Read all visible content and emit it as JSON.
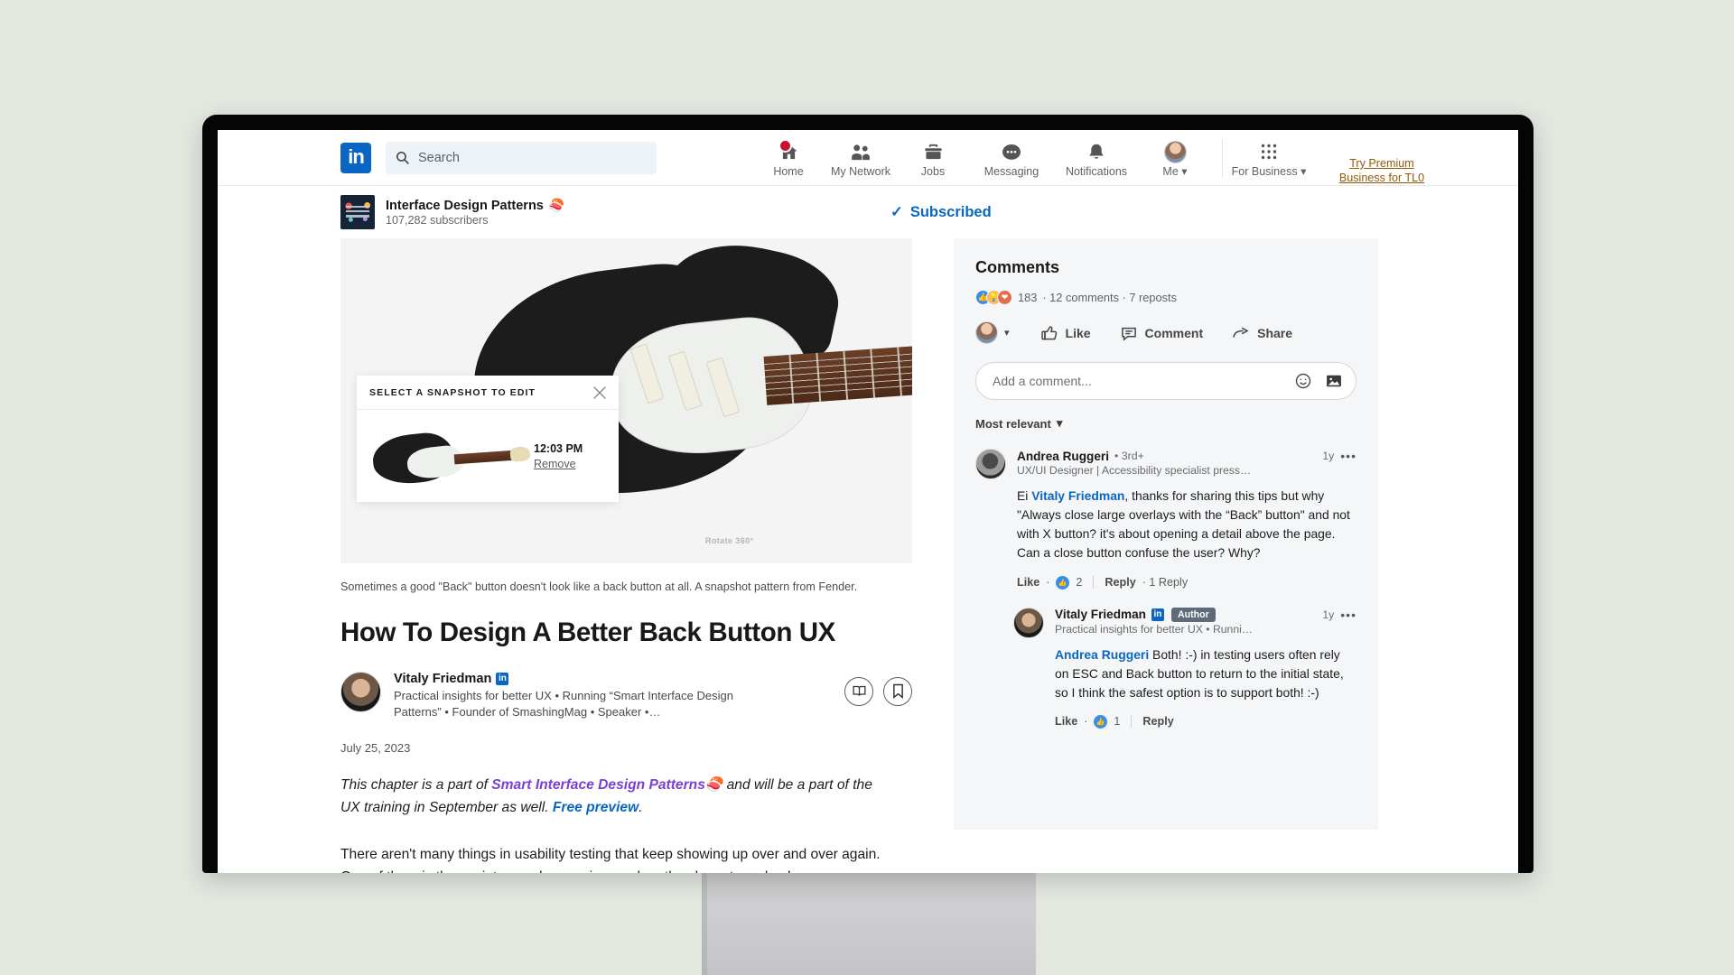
{
  "nav": {
    "logo_text": "in",
    "search_placeholder": "Search",
    "items": [
      {
        "label": "Home",
        "icon": "home-icon",
        "badge": true
      },
      {
        "label": "My Network",
        "icon": "people-icon",
        "badge": false
      },
      {
        "label": "Jobs",
        "icon": "briefcase-icon",
        "badge": false
      },
      {
        "label": "Messaging",
        "icon": "message-icon",
        "badge": false
      },
      {
        "label": "Notifications",
        "icon": "bell-icon",
        "badge": false
      },
      {
        "label": "Me",
        "icon": "avatar-icon",
        "badge": false
      }
    ],
    "for_business": "For Business",
    "premium_line1": "Try Premium",
    "premium_line2": "Business for TL0"
  },
  "newsletter": {
    "title": "Interface Design Patterns",
    "emoji": "🍣",
    "subscribers": "107,282 subscribers",
    "subscribed_label": "Subscribed",
    "check": "✓"
  },
  "hero": {
    "rotate_label": "Rotate 360°",
    "caption": "Sometimes a good \"Back\" button doesn't look like a back button at all. A snapshot pattern from Fender.",
    "modal": {
      "title": "SELECT A SNAPSHOT TO EDIT",
      "time": "12:03 PM",
      "remove": "Remove"
    }
  },
  "article": {
    "title": "How To Design A Better Back Button UX",
    "author_name": "Vitaly Friedman",
    "author_badge": "in",
    "author_headline": "Practical insights for better UX • Running “Smart Interface Design Patterns” • Founder of SmashingMag • Speaker •…",
    "date": "July 25, 2023",
    "lede_part1": "This chapter is a part of ",
    "lede_link1": "Smart Interface Design Patterns",
    "lede_emoji": "🍣",
    "lede_part2": " and will be a part of the UX training in September as well. ",
    "lede_link2": "Free preview",
    "lede_part3": ".",
    "body_paragraph": "There aren't many things in usability testing that keep showing up over and over again. One of them is the anxiety people experience when they have to go back."
  },
  "byline_actions": {
    "read_label": "book-open-icon",
    "save_label": "bookmark-icon"
  },
  "comments": {
    "heading": "Comments",
    "reaction_count": "183",
    "reactions_meta": "· 12 comments · 7 reposts",
    "actions": [
      {
        "label": "Like",
        "icon": "thumbs-up-icon"
      },
      {
        "label": "Comment",
        "icon": "comment-bubble-icon"
      },
      {
        "label": "Share",
        "icon": "share-arrow-icon"
      }
    ],
    "input_placeholder": "Add a comment...",
    "sort_label": "Most relevant",
    "list": [
      {
        "name": "Andrea Ruggeri",
        "degree": "• 3rd+",
        "headline": "UX/UI Designer | Accessibility specialist press…",
        "time": "1y",
        "mention": "Vitaly Friedman",
        "text_before": "Ei ",
        "text_after": ", thanks for sharing this tips but why \"Always close large overlays with the “Back” button\" and not with X button? it's about opening a detail above the page. Can a close button confuse the user? Why?",
        "like_label": "Like",
        "like_count": "2",
        "reply_label": "Reply",
        "replies_label": "· 1 Reply",
        "is_author": false,
        "badge": ""
      },
      {
        "name": "Vitaly Friedman",
        "degree": "",
        "headline": "Practical insights for better UX • Runni…",
        "time": "1y",
        "mention": "Andrea Ruggeri",
        "text_before": "",
        "text_after": " Both! :-) in testing users often rely on ESC and Back button to return to the initial state, so I think the safest option is to support both! :-)",
        "like_label": "Like",
        "like_count": "1",
        "reply_label": "Reply",
        "replies_label": "",
        "is_author": true,
        "badge": "Author"
      }
    ]
  },
  "colors": {
    "linkedin_blue": "#0a66c2",
    "premium_gold": "#915907",
    "purple_link": "#7a3fd4",
    "page_bg": "#e2e7e0",
    "comments_bg": "#f4f6f8"
  }
}
